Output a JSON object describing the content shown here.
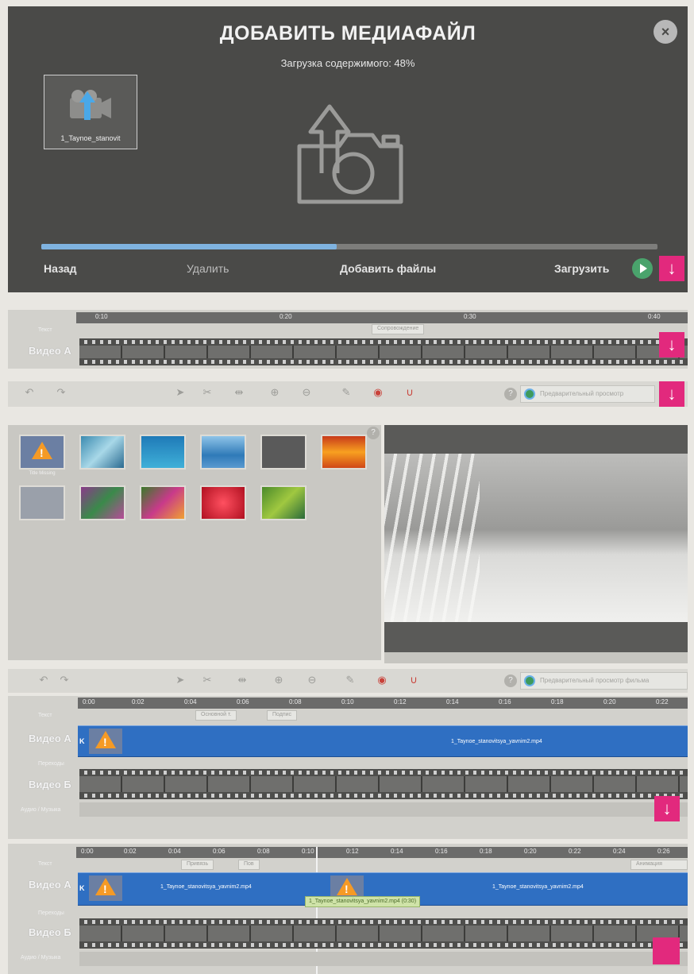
{
  "upload_dialog": {
    "title": "ДОБАВИТЬ МЕДИАФАЙЛ",
    "status": "Загрузка содержимого: 48%",
    "progress_fraction": 0.48,
    "close_label": "×",
    "file_thumb_caption": "1_Taynoe_stanovit",
    "back_label": "Назад",
    "delete_label": "Удалить",
    "add_files_label": "Добавить файлы",
    "upload_label": "Загрузить",
    "arrow_glyph": "↓"
  },
  "timeline_small": {
    "ticks": [
      "0:10",
      "0:20",
      "0:30",
      "0:40"
    ],
    "text_label": "Текст",
    "video_a_label": "Видео А",
    "text_chip": "Сопровождение"
  },
  "toolbar_1": {
    "undo_glyph": "↶",
    "redo_glyph": "↷",
    "help_glyph": "?",
    "preview_label": "Предварительный просмотр",
    "arrow_glyph": "↓"
  },
  "media_panel": {
    "help_glyph": "?",
    "captions": [
      "Title Missing",
      "",
      "",
      "",
      "",
      "",
      "",
      "",
      "",
      "",
      ""
    ]
  },
  "toolbar_2": {
    "undo_glyph": "↶",
    "redo_glyph": "↷",
    "help_glyph": "?",
    "preview_label": "Предварительный просмотр фильма"
  },
  "timeline_2": {
    "ticks": [
      "0:00",
      "0:02",
      "0:04",
      "0:06",
      "0:08",
      "0:10",
      "0:12",
      "0:14",
      "0:16",
      "0:18",
      "0:20",
      "0:22"
    ],
    "text_label": "Текст",
    "video_a_label": "Видео А",
    "transitions_label": "Переходы",
    "video_b_label": "Видео Б",
    "audio_label": "Аудио / Музыка",
    "chip_1": "Основной т.",
    "chip_2": "Подпис",
    "clip_name": "1_Taynoe_stanovitsya_yavnim2.mp4",
    "k_mark": "K",
    "arrow_glyph": "↓"
  },
  "timeline_3": {
    "ticks": [
      "0:00",
      "0:02",
      "0:04",
      "0:06",
      "0:08",
      "0:10",
      "0:12",
      "0:14",
      "0:16",
      "0:18",
      "0:20",
      "0:22",
      "0:24",
      "0:26"
    ],
    "text_label": "Текст",
    "video_a_label": "Видео А",
    "transitions_label": "Переходы",
    "video_b_label": "Видео Б",
    "audio_label": "Аудио / Музыка",
    "chip_1": "Привязь",
    "chip_2": "Пов",
    "chip_right": "Анимация",
    "clip_name_1": "1_Taynoe_stanovitsya_yavnim2.mp4",
    "clip_name_2": "1_Taynoe_stanovitsya_yavnim2.mp4",
    "tooltip": "1_Taynoe_stanovitsya_yavnim2.mp4 (0:30)",
    "k_mark": "K"
  },
  "colors": {
    "accent_pink": "#e2297d",
    "clip_blue": "#2f6fc2",
    "progress_blue": "#7fb3e0",
    "dialog_bg": "#4a4a48"
  }
}
